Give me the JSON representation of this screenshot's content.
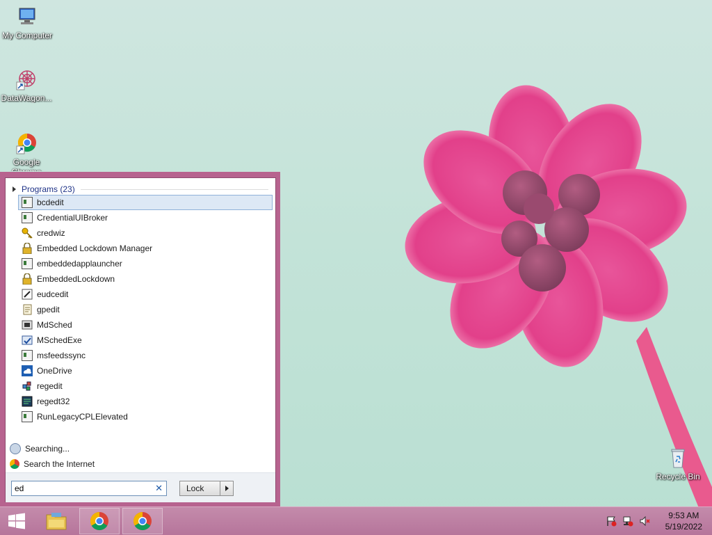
{
  "desktop": {
    "icons": [
      {
        "label": "My Computer"
      },
      {
        "label": "DataWagon..."
      },
      {
        "label": "Google Chrome"
      },
      {
        "label": "Recycle Bin"
      }
    ]
  },
  "start_menu": {
    "programs_header": "Programs (23)",
    "programs": [
      {
        "label": "bcdedit",
        "icon": "app-window-icon"
      },
      {
        "label": "CredentialUIBroker",
        "icon": "app-window-icon"
      },
      {
        "label": "credwiz",
        "icon": "key-icon"
      },
      {
        "label": "Embedded Lockdown Manager",
        "icon": "lock-icon"
      },
      {
        "label": "embeddedapplauncher",
        "icon": "app-window-icon"
      },
      {
        "label": "EmbeddedLockdown",
        "icon": "lock-icon"
      },
      {
        "label": "eudcedit",
        "icon": "pen-icon"
      },
      {
        "label": "gpedit",
        "icon": "document-icon"
      },
      {
        "label": "MdSched",
        "icon": "memory-diagnostic-icon"
      },
      {
        "label": "MSchedExe",
        "icon": "schedule-icon"
      },
      {
        "label": "msfeedssync",
        "icon": "app-window-icon"
      },
      {
        "label": "OneDrive",
        "icon": "onedrive-icon"
      },
      {
        "label": "regedit",
        "icon": "registry-icon"
      },
      {
        "label": "regedt32",
        "icon": "registry-editor-icon"
      },
      {
        "label": "RunLegacyCPLElevated",
        "icon": "app-window-icon"
      }
    ],
    "searching_label": "Searching...",
    "search_internet_label": "Search the Internet",
    "search_value": "ed",
    "lock_label": "Lock"
  },
  "taskbar": {
    "clock_time": "9:53 AM",
    "clock_date": "5/19/2022"
  }
}
